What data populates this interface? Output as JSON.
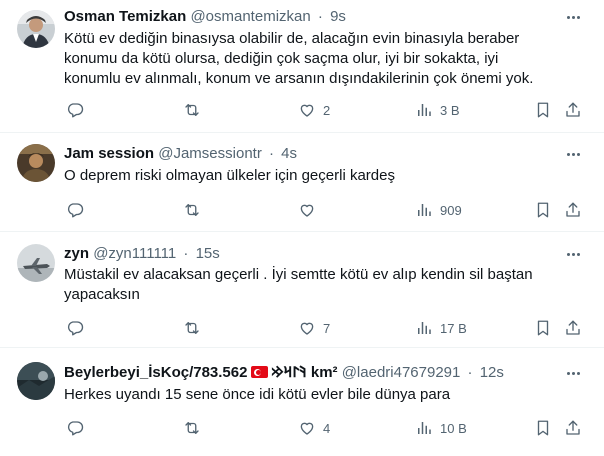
{
  "tweets": [
    {
      "name": "Osman Temizkan",
      "handle": "@osmantemizkan",
      "separator": "·",
      "time": "9s",
      "text": "Kötü ev dediğin binasıysa olabilir de, alacağın evin binasıyla beraber konumu da kötü olursa, dediğin çok saçma olur, iyi bir sokakta, iyi konumlu ev alınmalı, konum ve arsanın dışındakilerinin çok önemi yok.",
      "replies": "",
      "retweets": "",
      "likes": "2",
      "views": "3 B"
    },
    {
      "name": "Jam session",
      "handle": "@Jamsessiontr",
      "separator": "·",
      "time": "4s",
      "text": "O deprem riski olmayan ülkeler için geçerli kardeş",
      "replies": "",
      "retweets": "",
      "likes": "",
      "views": "909"
    },
    {
      "name": "zyn",
      "handle": "@zyn111111",
      "separator": "·",
      "time": "15s",
      "text": "Müstakil ev alacaksan geçerli . İyi semtte kötü ev alıp kendin sil baştan yapacaksın",
      "replies": "",
      "retweets": "",
      "likes": "7",
      "views": "17 B"
    },
    {
      "name": "Beylerbeyi_İsKoç/783.562",
      "name_suffix": "𐰚𐰃𐰺𐰢 km²",
      "handle": "@laedri47679291",
      "separator": "·",
      "time": "12s",
      "text": "Herkes uyandı 15 sene önce idi kötü evler bile dünya para",
      "replies": "",
      "retweets": "",
      "likes": "4",
      "views": "10 B"
    }
  ],
  "icons": {
    "reply": "reply-icon",
    "retweet": "retweet-icon",
    "like": "like-icon",
    "views": "views-icon",
    "bookmark": "bookmark-icon",
    "share": "share-icon",
    "more": "more-icon",
    "flag": "turkey-flag-icon"
  },
  "colors": {
    "text": "#0f1419",
    "secondary": "#536471",
    "divider": "#eff3f4",
    "flag_red": "#e30a17"
  }
}
